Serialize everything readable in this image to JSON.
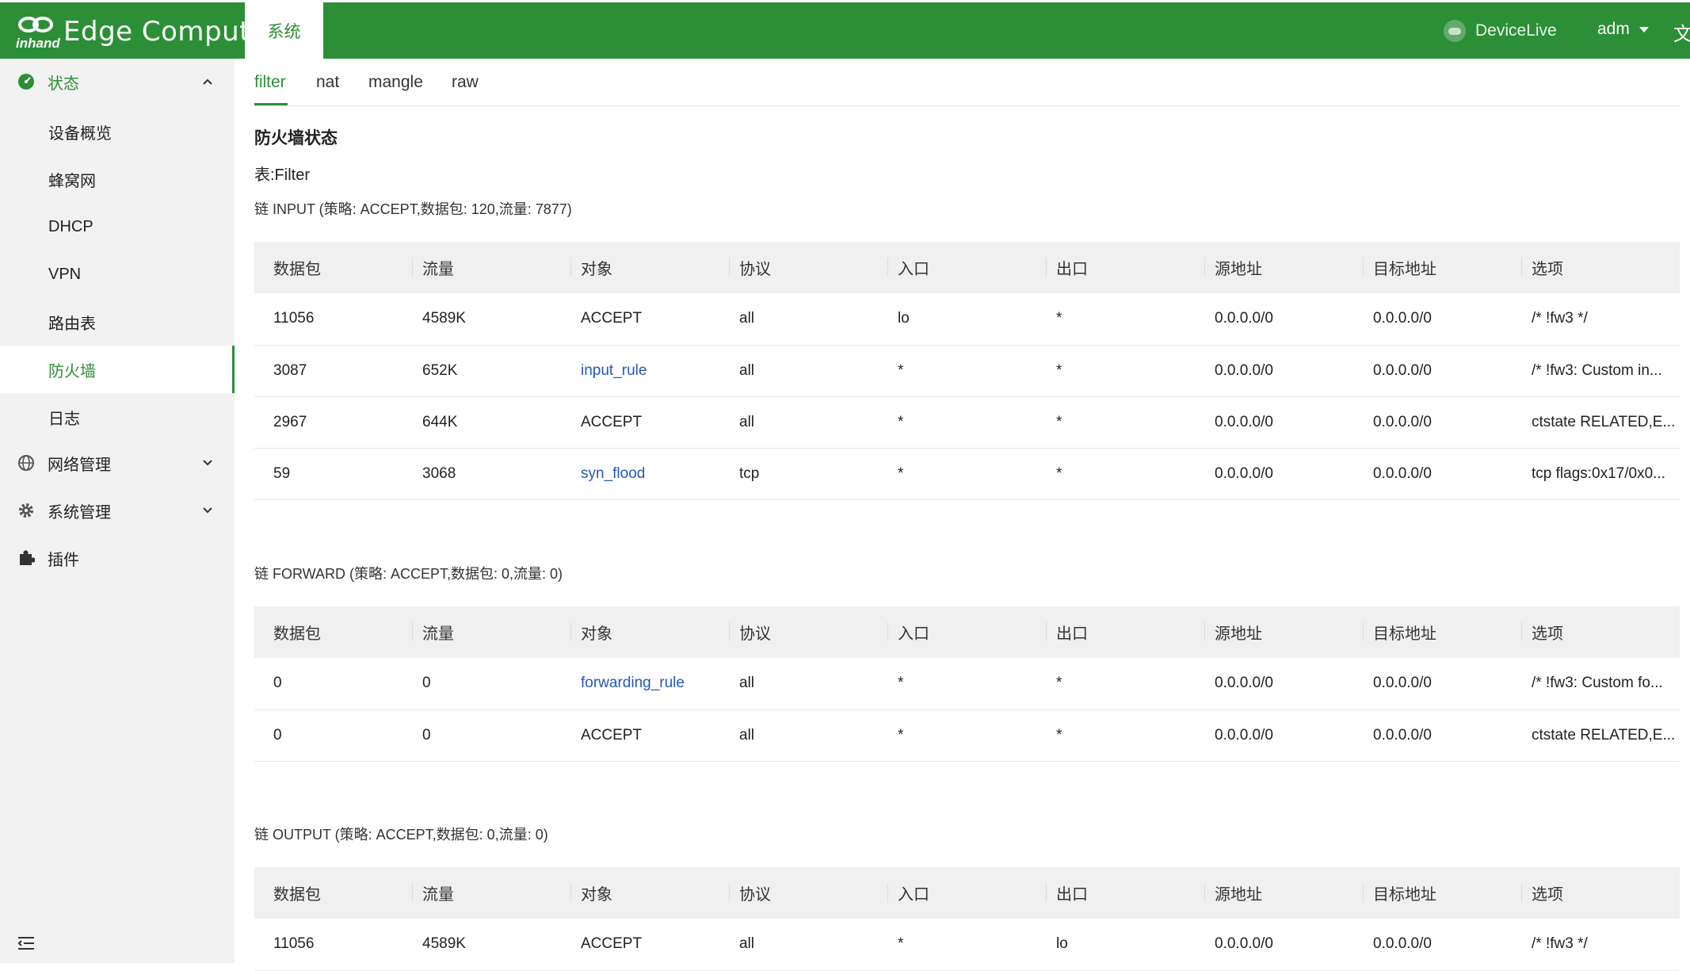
{
  "header": {
    "logo_sub": "inhand",
    "logo_text": "Edge Computer",
    "nav_tab": "系统",
    "devicelive": "DeviceLive",
    "user": "adm",
    "lang_glyph": "文"
  },
  "sidebar": {
    "status_group": "状态",
    "items": [
      "设备概览",
      "蜂窝网",
      "DHCP",
      "VPN",
      "路由表",
      "防火墙",
      "日志"
    ],
    "active_item": "防火墙",
    "network_group": "网络管理",
    "system_group": "系统管理",
    "plugins_group": "插件"
  },
  "subtabs": [
    "filter",
    "nat",
    "mangle",
    "raw"
  ],
  "page": {
    "title": "防火墙状态",
    "table_label": "表:Filter"
  },
  "columns": [
    "数据包",
    "流量",
    "对象",
    "协议",
    "入口",
    "出口",
    "源地址",
    "目标地址",
    "选项"
  ],
  "chains": [
    {
      "label": "链 INPUT (策略: ACCEPT,数据包: 120,流量: 7877)",
      "rows": [
        [
          "11056",
          "4589K",
          "ACCEPT",
          "all",
          "lo",
          "*",
          "0.0.0.0/0",
          "0.0.0.0/0",
          "/* !fw3 */"
        ],
        [
          "3087",
          "652K",
          "input_rule",
          "all",
          "*",
          "*",
          "0.0.0.0/0",
          "0.0.0.0/0",
          "/* !fw3: Custom in..."
        ],
        [
          "2967",
          "644K",
          "ACCEPT",
          "all",
          "*",
          "*",
          "0.0.0.0/0",
          "0.0.0.0/0",
          "ctstate RELATED,E..."
        ],
        [
          "59",
          "3068",
          "syn_flood",
          "tcp",
          "*",
          "*",
          "0.0.0.0/0",
          "0.0.0.0/0",
          "tcp flags:0x17/0x0..."
        ]
      ]
    },
    {
      "label": "链 FORWARD (策略: ACCEPT,数据包: 0,流量: 0)",
      "rows": [
        [
          "0",
          "0",
          "forwarding_rule",
          "all",
          "*",
          "*",
          "0.0.0.0/0",
          "0.0.0.0/0",
          "/* !fw3: Custom fo..."
        ],
        [
          "0",
          "0",
          "ACCEPT",
          "all",
          "*",
          "*",
          "0.0.0.0/0",
          "0.0.0.0/0",
          "ctstate RELATED,E..."
        ]
      ]
    },
    {
      "label": "链 OUTPUT (策略: ACCEPT,数据包: 0,流量: 0)",
      "rows": [
        [
          "11056",
          "4589K",
          "ACCEPT",
          "all",
          "*",
          "lo",
          "0.0.0.0/0",
          "0.0.0.0/0",
          "/* !fw3 */"
        ]
      ]
    }
  ],
  "link_targets": [
    "input_rule",
    "syn_flood",
    "forwarding_rule"
  ],
  "colors": {
    "brand": "#2c8f37",
    "link": "#2559b5",
    "sidebar_bg": "#f2f2f2",
    "header_row_bg": "#f0f0f0"
  },
  "icons": [
    "dashboard-icon",
    "globe-icon",
    "gear-icon",
    "puzzle-icon",
    "chevron-up-icon",
    "chevron-down-icon",
    "menu-collapse-icon",
    "cloud-icon",
    "translate-icon"
  ]
}
